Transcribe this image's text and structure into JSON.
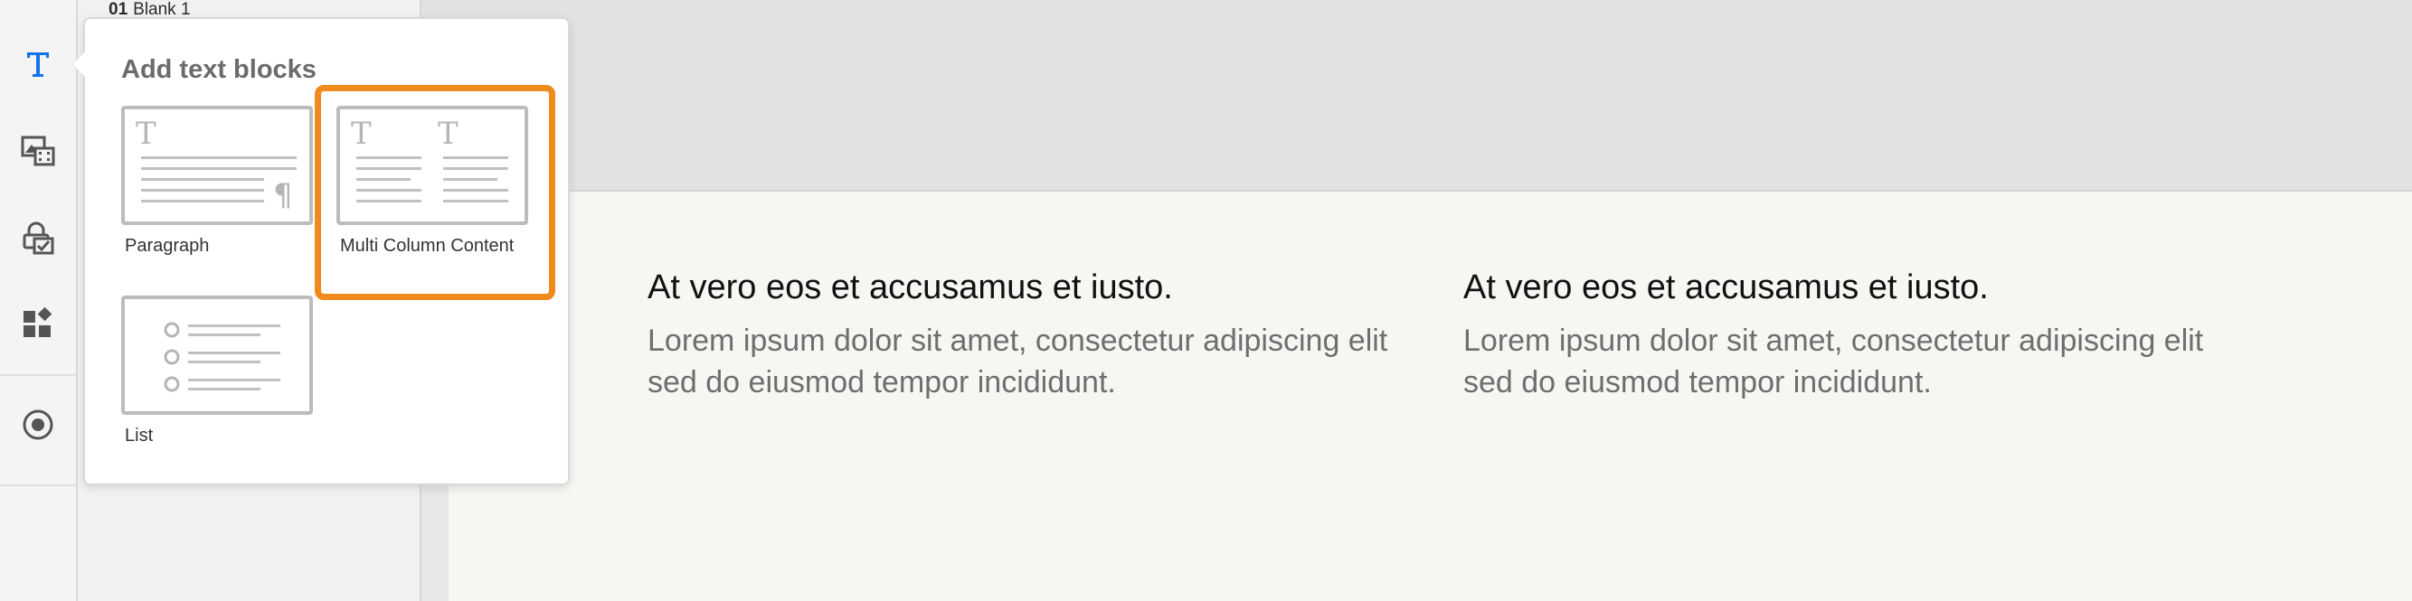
{
  "window": {
    "title": "Add text blocks"
  },
  "pages_panel": {
    "current_page_number": "01",
    "current_page_name": "Blank 1"
  },
  "rail": {
    "items": [
      {
        "icon": "text-icon",
        "active": true
      },
      {
        "icon": "media-icon",
        "active": false
      },
      {
        "icon": "interactive-icon",
        "active": false
      },
      {
        "icon": "widgets-icon",
        "active": false
      },
      {
        "icon": "record-icon",
        "active": false
      }
    ],
    "accent_color": "#1473e6"
  },
  "popover": {
    "title": "Add text blocks",
    "blocks": [
      {
        "label": "Paragraph",
        "icon": "paragraph-block-icon"
      },
      {
        "label": "Multi Column Content",
        "icon": "multi-column-block-icon",
        "highlighted": true
      },
      {
        "label": "List",
        "icon": "list-block-icon"
      }
    ],
    "highlight_color": "#f08a1c"
  },
  "canvas": {
    "columns": [
      {
        "heading": "At vero eos et accusamus et iusto.",
        "body": "Lorem ipsum dolor sit amet, consectetur adipiscing elit sed do eiusmod tempor incididunt."
      },
      {
        "heading": "At vero eos et accusamus et iusto.",
        "body": "Lorem ipsum dolor sit amet, consectetur adipiscing elit sed do eiusmod tempor incididunt."
      }
    ]
  }
}
